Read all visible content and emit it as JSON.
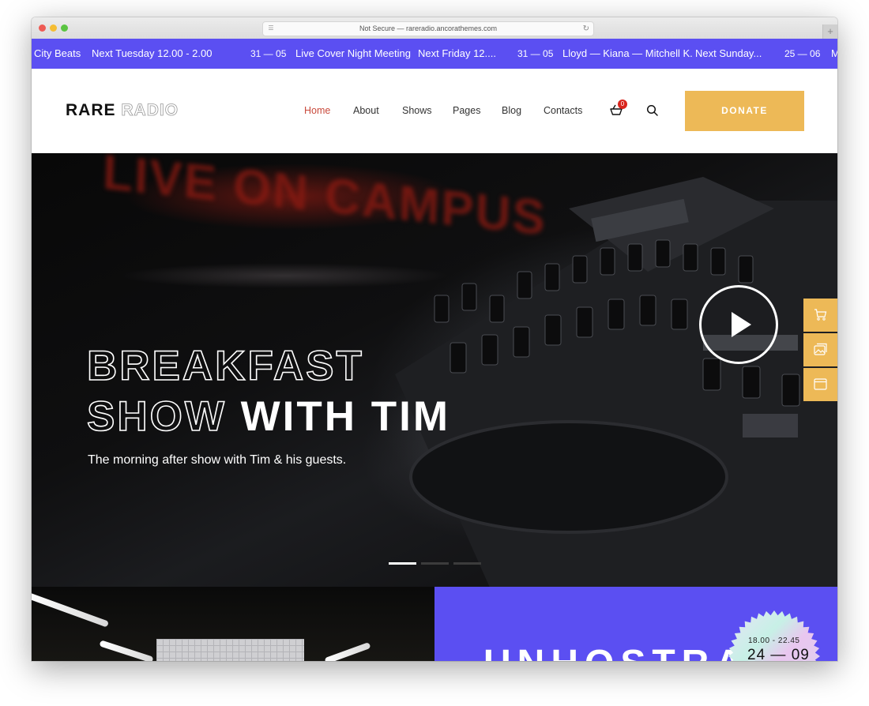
{
  "browser": {
    "url_text": "Not Secure — rareradio.ancorathemes.com",
    "new_tab_label": "+"
  },
  "ticker": {
    "items": [
      {
        "text": "City Beats"
      },
      {
        "text": "Next Tuesday 12.00 - 2.00"
      },
      {
        "text": "31 — 05"
      },
      {
        "text": "Live Cover Night Meeting"
      },
      {
        "text": "Next Friday 12...."
      },
      {
        "text": "31 — 05"
      },
      {
        "text": "Lloyd — Kiana — Mitchell K."
      },
      {
        "text": "Next Sunday..."
      },
      {
        "text": "25 — 06"
      },
      {
        "text": "M"
      }
    ]
  },
  "header": {
    "logo_solid": "RARE",
    "logo_outline": "RADIO",
    "nav": [
      {
        "label": "Home",
        "active": true
      },
      {
        "label": "About"
      },
      {
        "label": "Shows"
      },
      {
        "label": "Pages"
      },
      {
        "label": "Blog"
      },
      {
        "label": "Contacts"
      }
    ],
    "cart_count": "0",
    "donate_label": "DONATE"
  },
  "hero": {
    "bg_sign_text": "LIVE ON CAMPUS",
    "title_line1_outline": "BREAKFAST",
    "title_line2_outline": "SHOW",
    "title_line2_solid": "WITH TIM",
    "subtitle": "The morning after show with Tim & his guests.",
    "slides_total": 3,
    "active_slide": 1
  },
  "side_panel": {
    "items": [
      "cart-icon",
      "image-icon",
      "window-icon"
    ]
  },
  "promo": {
    "title_partial": "UNHOSTRABL",
    "badge_time": "18.00 - 22.45",
    "badge_date": "24 — 09"
  },
  "colors": {
    "accent_purple": "#5b4ff2",
    "accent_yellow": "#edb957",
    "active_nav": "#c94a3c",
    "badge_red": "#d9251d"
  }
}
